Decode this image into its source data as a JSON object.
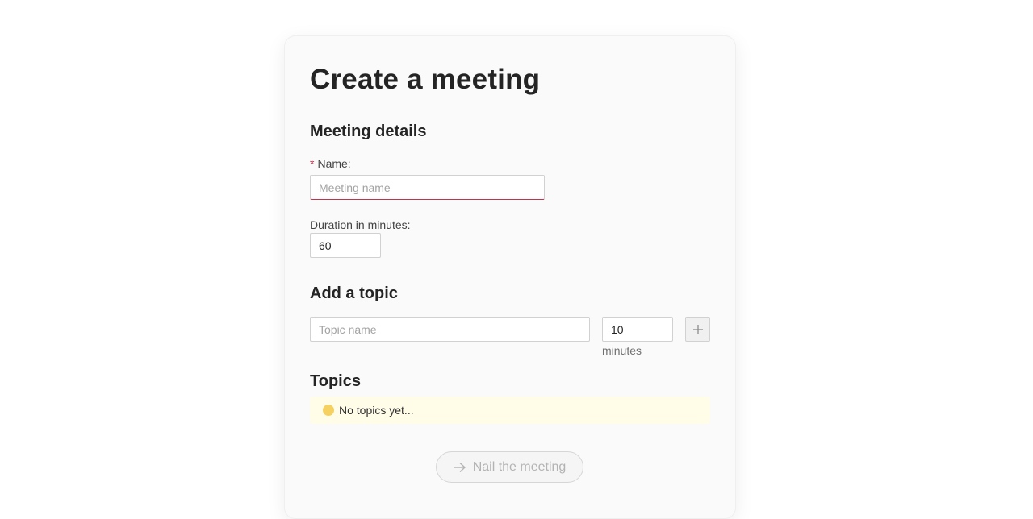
{
  "page": {
    "title": "Create a meeting"
  },
  "meeting_details": {
    "heading": "Meeting details",
    "name": {
      "required_marker": "*",
      "label": "Name:",
      "placeholder": "Meeting name",
      "value": ""
    },
    "duration": {
      "label": "Duration in minutes:",
      "value": "60"
    }
  },
  "add_topic": {
    "heading": "Add a topic",
    "topic_placeholder": "Topic name",
    "minutes_value": "10",
    "minutes_hint": "minutes",
    "add_icon": "plus-icon"
  },
  "topics": {
    "heading": "Topics",
    "empty_message": "No topics yet...",
    "empty_icon": "info-dot-icon",
    "items": []
  },
  "submit": {
    "label": "Nail the meeting",
    "icon": "arrow-right-icon",
    "disabled": true
  },
  "colors": {
    "required": "#c4314b",
    "empty_state_bg": "#fffce8",
    "empty_state_dot": "#f5d162"
  }
}
